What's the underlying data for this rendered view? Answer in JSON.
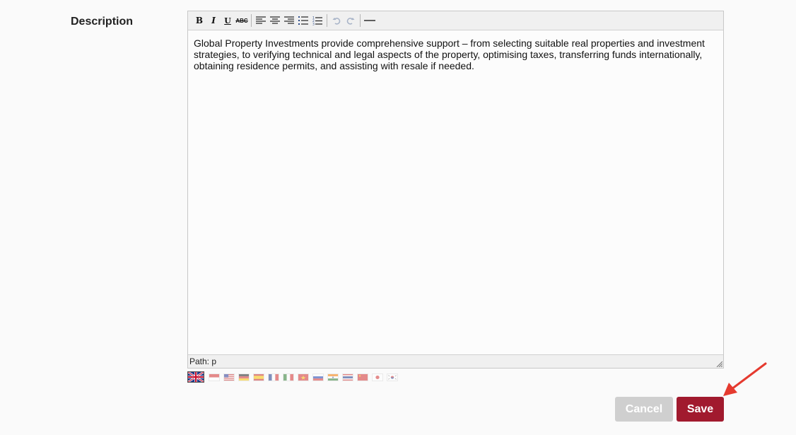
{
  "form": {
    "description_label": "Description"
  },
  "editor": {
    "toolbar": {
      "bold": "B",
      "italic": "I",
      "underline": "U",
      "strike": "ABC",
      "icons": [
        "bold-icon",
        "italic-icon",
        "underline-icon",
        "strikethrough-icon",
        "align-left-icon",
        "align-center-icon",
        "align-right-icon",
        "bullet-list-icon",
        "numbered-list-icon",
        "undo-icon",
        "redo-icon",
        "horizontal-rule-icon"
      ]
    },
    "content": "Global Property Investments provide comprehensive support – from selecting suitable real properties and investment strategies, to verifying technical and legal aspects of the property, optimising taxes, transferring funds internationally, obtaining residence permits, and assisting with resale if needed.",
    "path": "Path: p"
  },
  "languages": [
    {
      "code": "en",
      "active": true
    },
    {
      "code": "id"
    },
    {
      "code": "us"
    },
    {
      "code": "de"
    },
    {
      "code": "es"
    },
    {
      "code": "fr"
    },
    {
      "code": "it"
    },
    {
      "code": "vn"
    },
    {
      "code": "ru"
    },
    {
      "code": "in"
    },
    {
      "code": "th"
    },
    {
      "code": "cn"
    },
    {
      "code": "jp"
    },
    {
      "code": "kr"
    }
  ],
  "actions": {
    "cancel_label": "Cancel",
    "save_label": "Save"
  },
  "colors": {
    "save": "#a11a2e",
    "cancel": "#cfcfcf",
    "annotation_arrow": "#e53a2f"
  }
}
